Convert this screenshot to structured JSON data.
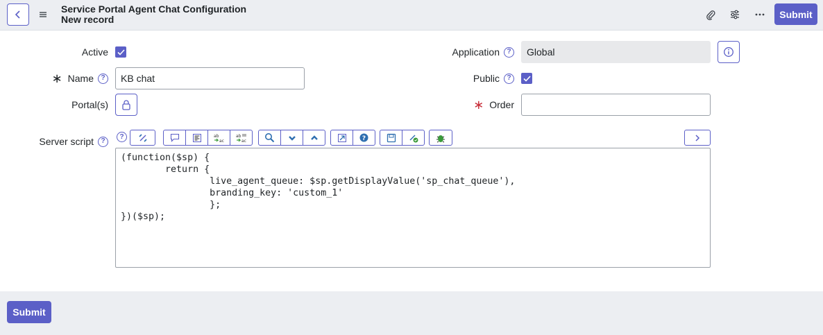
{
  "header": {
    "title": "Service Portal Agent Chat Configuration",
    "subtitle": "New record",
    "submit_label": "Submit"
  },
  "form": {
    "active": {
      "label": "Active",
      "checked": true
    },
    "name": {
      "label": "Name",
      "value": "KB chat",
      "required": true
    },
    "portals": {
      "label": "Portal(s)"
    },
    "application": {
      "label": "Application",
      "value": "Global"
    },
    "public": {
      "label": "Public",
      "checked": true
    },
    "order": {
      "label": "Order",
      "value": "",
      "required": true
    },
    "server_script": {
      "label": "Server script",
      "lines": [
        "(function($sp) {",
        "        return {",
        "                live_agent_queue: $sp.getDisplayValue('sp_chat_queue'),",
        "                branding_key: 'custom_1'",
        "                };",
        "})($sp);"
      ]
    }
  },
  "footer": {
    "submit_label": "Submit"
  },
  "help_glyph": "?",
  "required_glyph": "∗",
  "colors": {
    "accent": "#5b5fc7",
    "required": "#c8303b",
    "header_bg": "#eceef2"
  }
}
